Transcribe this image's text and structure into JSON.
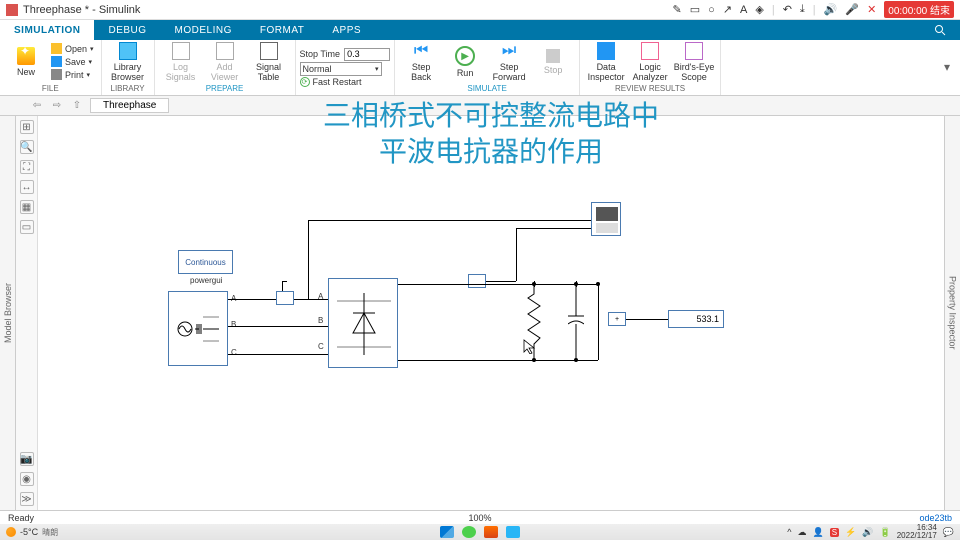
{
  "title": "Threephase * - Simulink",
  "titlebar_timer": "00:00:00 结束",
  "tabs": [
    "SIMULATION",
    "DEBUG",
    "MODELING",
    "FORMAT",
    "APPS"
  ],
  "file_menu": {
    "new": "New",
    "open": "Open",
    "save": "Save",
    "print": "Print",
    "label": "FILE"
  },
  "library": {
    "browser": "Library\nBrowser",
    "label": "LIBRARY"
  },
  "prepare": {
    "log": "Log\nSignals",
    "viewer": "Add\nViewer",
    "table": "Signal\nTable",
    "label": "PREPARE"
  },
  "simulate": {
    "stoptime_label": "Stop Time",
    "stoptime_value": "0.3",
    "mode": "Normal",
    "fast_restart": "Fast Restart",
    "step_back": "Step\nBack",
    "run": "Run",
    "step_fw": "Step\nForward",
    "stop": "Stop",
    "label": "SIMULATE"
  },
  "review": {
    "data_insp": "Data\nInspector",
    "logic": "Logic\nAnalyzer",
    "birdseye": "Bird's-Eye\nScope",
    "label": "REVIEW RESULTS"
  },
  "breadcrumb": "Threephase",
  "left_panel": "Model Browser",
  "right_panel": "Property Inspector",
  "overlay": {
    "line1": "三相桥式不可控整流电路中",
    "line2": "平波电抗器的作用"
  },
  "blocks": {
    "powergui": "Continuous",
    "powergui_label": "powergui",
    "ports": {
      "a": "A",
      "b": "B",
      "c": "C"
    },
    "display_value": "533.1"
  },
  "status": {
    "left": "Ready",
    "center": "100%",
    "right": "ode23tb"
  },
  "taskbar": {
    "temp": "-5°C",
    "cond": "晴朗",
    "time": "16:34",
    "date": "2022/12/17"
  }
}
